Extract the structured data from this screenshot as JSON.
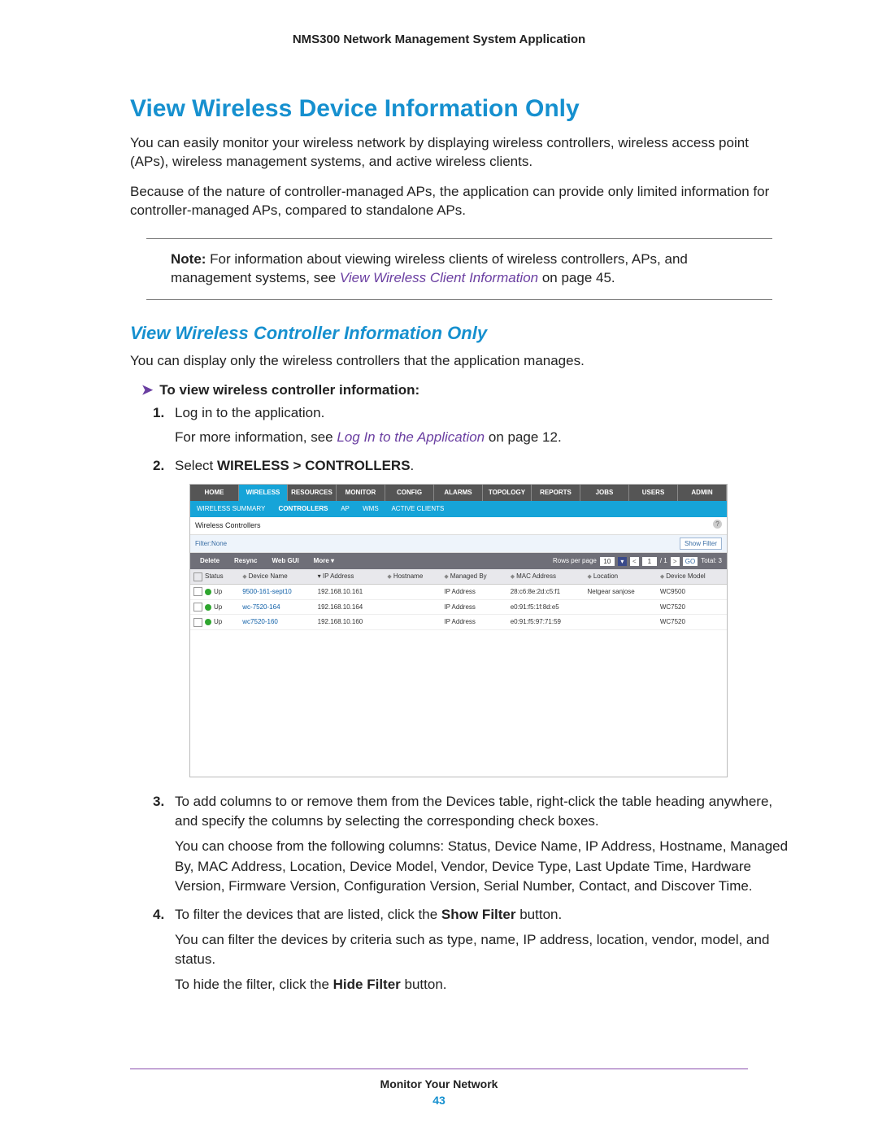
{
  "header": "NMS300 Network Management System Application",
  "h1": "View Wireless Device Information Only",
  "p1": "You can easily monitor your wireless network by displaying wireless controllers, wireless access point (APs), wireless management systems, and active wireless clients.",
  "p2": "Because of the nature of controller-managed APs, the application can provide only limited information for controller-managed APs, compared to standalone APs.",
  "note": {
    "label": "Note:",
    "text1": "  For information about viewing wireless clients of wireless controllers, APs, and management systems, see ",
    "link": "View Wireless Client Information",
    "text2": " on page 45."
  },
  "h2": "View Wireless Controller Information Only",
  "p3": "You can display only the wireless controllers that the application manages.",
  "procTitle": "To view wireless controller information:",
  "steps": {
    "s1": "Log in to the application.",
    "s1b_a": "For more information, see ",
    "s1b_link": "Log In to the Application",
    "s1b_b": " on page 12.",
    "s2_a": "Select ",
    "s2_b": "WIRELESS > CONTROLLERS",
    "s2_c": ".",
    "s3": "To add columns to or remove them from the Devices table, right-click the table heading anywhere, and specify the columns by selecting the corresponding check boxes.",
    "s3b": "You can choose from the following columns: Status, Device Name, IP Address, Hostname, Managed By, MAC Address, Location, Device Model, Vendor, Device Type, Last Update Time, Hardware Version, Firmware Version, Configuration Version, Serial Number, Contact, and Discover Time.",
    "s4_a": "To filter the devices that are listed, click the ",
    "s4_b": "Show Filter",
    "s4_c": " button.",
    "s4d": "You can filter the devices by criteria such as type, name, IP address, location, vendor, model, and status.",
    "s4e_a": "To hide the filter, click the ",
    "s4e_b": "Hide Filter",
    "s4e_c": " button."
  },
  "shot": {
    "nav": [
      "HOME",
      "WIRELESS",
      "RESOURCES",
      "MONITOR",
      "CONFIG",
      "ALARMS",
      "TOPOLOGY",
      "REPORTS",
      "JOBS",
      "USERS",
      "ADMIN"
    ],
    "subnav": [
      "WIRELESS SUMMARY",
      "CONTROLLERS",
      "AP",
      "WMS",
      "ACTIVE CLIENTS"
    ],
    "panelTitle": "Wireless Controllers",
    "filterLabel": "Filter:None",
    "showFilter": "Show Filter",
    "toolbar": {
      "delete": "Delete",
      "resync": "Resync",
      "webgui": "Web GUI",
      "more": "More ▾",
      "rpp": "Rows per page",
      "rppVal": "10",
      "page": "1",
      "of": "/ 1",
      "go": "GO",
      "total": "Total: 3"
    },
    "cols": [
      "Status",
      "Device Name",
      "IP Address",
      "Hostname",
      "Managed By",
      "MAC Address",
      "Location",
      "Device Model"
    ],
    "rows": [
      {
        "status": "Up",
        "name": "9500-161-sept10",
        "ip": "192.168.10.161",
        "host": "",
        "mb": "IP Address",
        "mac": "28:c6:8e:2d:c5:f1",
        "loc": "Netgear sanjose",
        "model": "WC9500"
      },
      {
        "status": "Up",
        "name": "wc-7520-164",
        "ip": "192.168.10.164",
        "host": "",
        "mb": "IP Address",
        "mac": "e0:91:f5:1f:8d:e5",
        "loc": "",
        "model": "WC7520"
      },
      {
        "status": "Up",
        "name": "wc7520-160",
        "ip": "192.168.10.160",
        "host": "",
        "mb": "IP Address",
        "mac": "e0:91:f5:97:71:59",
        "loc": "",
        "model": "WC7520"
      }
    ]
  },
  "footer": {
    "title": "Monitor Your Network",
    "page": "43"
  }
}
